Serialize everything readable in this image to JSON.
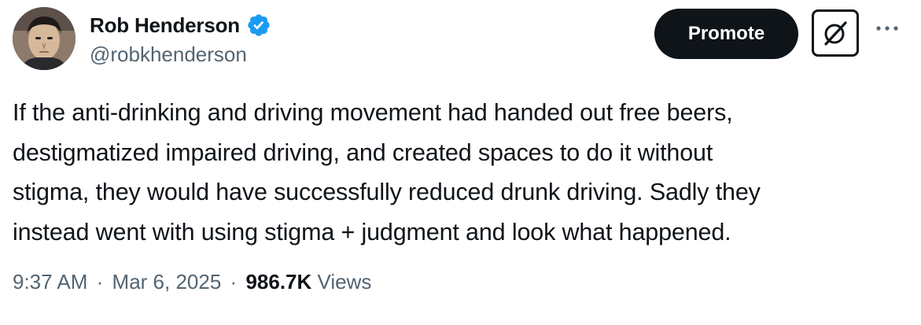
{
  "author": {
    "display_name": "Rob Henderson",
    "handle": "@robkhenderson",
    "verified_icon": "verified-badge-icon",
    "badge_color": "#1d9bf0"
  },
  "actions": {
    "promote_label": "Promote",
    "grok_icon": "grok-icon",
    "more_icon": "more-options-icon"
  },
  "tweet": {
    "lines": [
      "If the anti-drinking and driving movement had handed out free beers,",
      "destigmatized impaired driving, and created spaces to do it without",
      "stigma, they would have successfully reduced drunk driving. Sadly they",
      "instead went with using stigma + judgment and look what happened."
    ]
  },
  "meta": {
    "time": "9:37 AM",
    "separator": "·",
    "date": "Mar 6, 2025",
    "views_count": "986.7K",
    "views_label": "Views"
  }
}
